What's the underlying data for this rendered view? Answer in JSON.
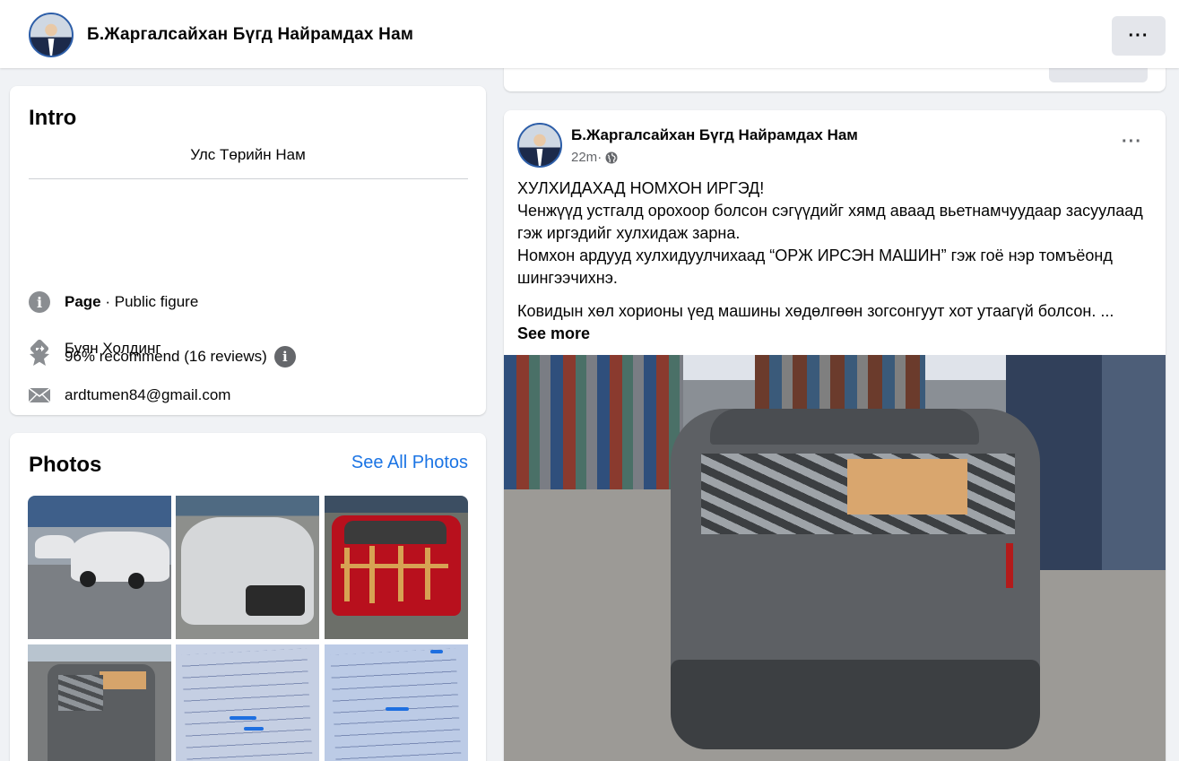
{
  "header": {
    "page_name": "Б.Жаргалсайхан Бүгд Найрамдах Нам",
    "more_label": "···"
  },
  "intro": {
    "title": "Intro",
    "bio": "Улс Төрийн Нам",
    "category_bold": "Page",
    "category_rest": " · Public figure",
    "company": "Буян Холдинг",
    "email": "ardtumen84@gmail.com",
    "recommend": "96% recommend (16 reviews)",
    "info_glyph": "i"
  },
  "photos": {
    "title": "Photos",
    "see_all": "See All Photos"
  },
  "post": {
    "author": "Б.Жаргалсайхан Бүгд Найрамдах Нам",
    "time": "22m",
    "separator": " · ",
    "more_label": "···",
    "line1": "ХУЛХИДАХАД НОМХОН ИРГЭД!",
    "line2": "Ченжүүд устгалд орохоор болсон сэгүүдийг хямд аваад вьетнамчуудаар засуулаад гэж иргэдийг хулхидаж зарна.",
    "line3": "Номхон ардууд хулхидуулчихаад “ОРЖ ИРСЭН МАШИН” гэж гоё нэр томъёонд шингээчихнэ.",
    "line4": "Ковидын хөл хорионы үед машины хөдөлгөөн зогсонгуут хот утаагүй болсон. ...",
    "see_more": "See more"
  },
  "colors": {
    "link_blue": "#1b74e4",
    "page_bg": "#f0f2f5",
    "secondary_text": "#65676b"
  }
}
